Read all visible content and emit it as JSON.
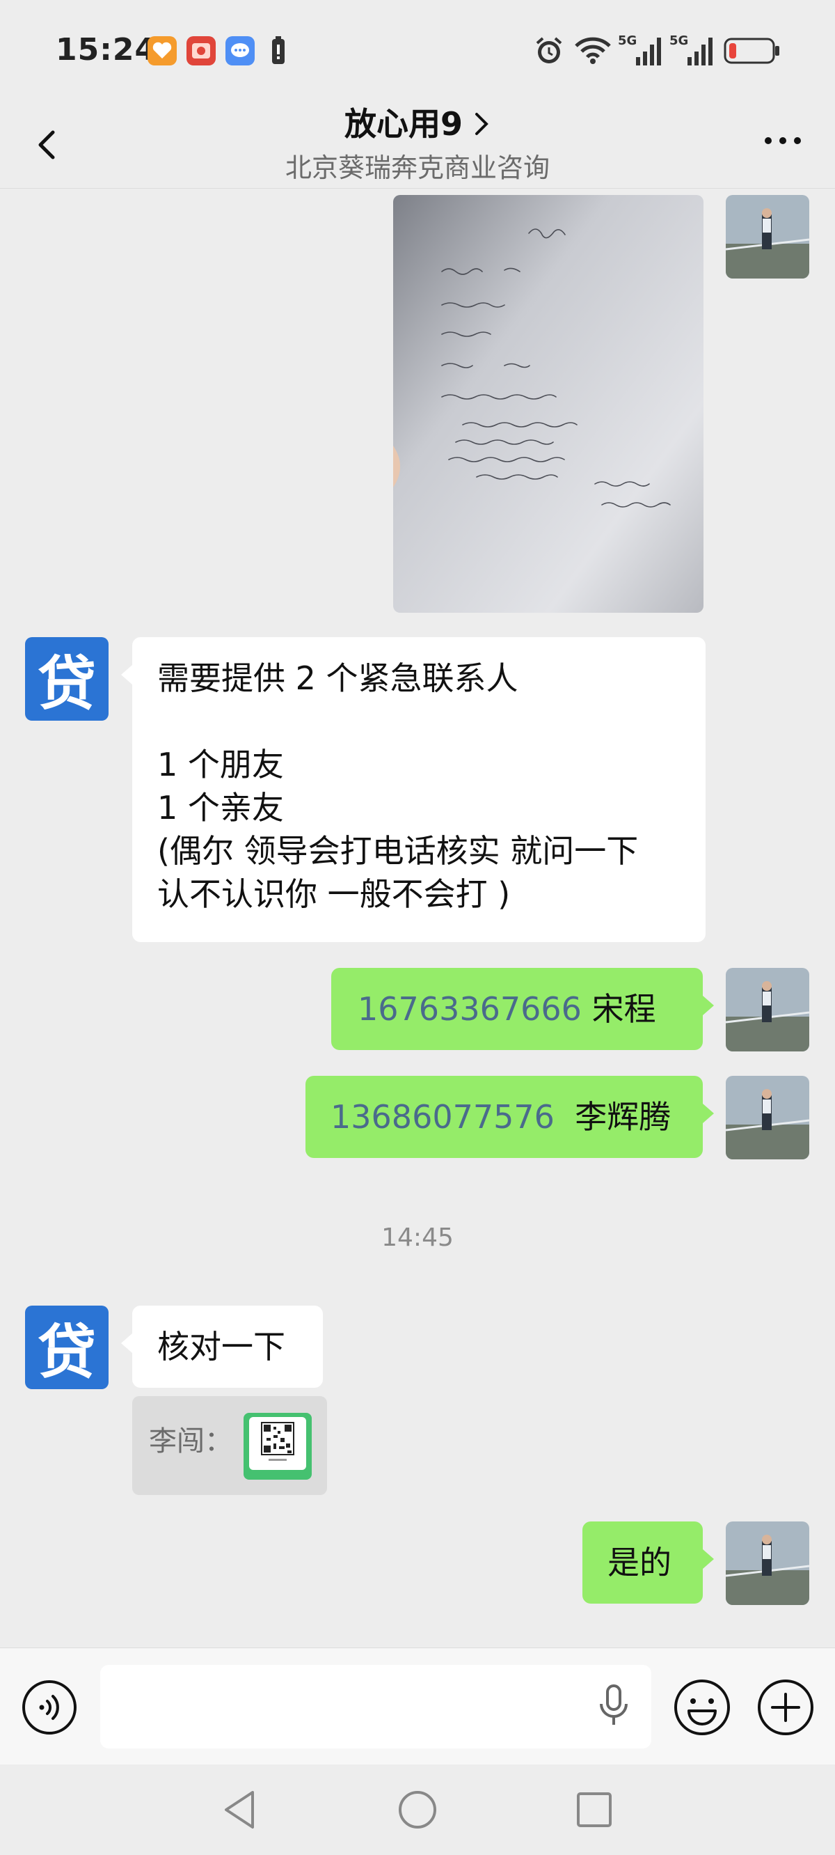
{
  "status_bar": {
    "time": "15:24",
    "icons": [
      "app-heart-icon",
      "app-red-icon",
      "message-icon",
      "battery-saver-icon",
      "alarm-icon",
      "wifi-icon",
      "signal-5g-1-icon",
      "signal-5g-2-icon",
      "battery-low-icon"
    ]
  },
  "header": {
    "title": "放心用9",
    "subtitle": "北京葵瑞奔克商业咨询"
  },
  "messages": {
    "m1": {
      "side": "right",
      "type": "image",
      "content": "handwritten IOU note"
    },
    "m2": {
      "side": "left",
      "avatar_text": "贷",
      "line1": "需要提供 2 个紧急联系人",
      "line2": "1 个朋友",
      "line3": "1 个亲友",
      "line4": "(偶尔 领导会打电话核实 就问一下",
      "line5": "认不认识你  一般不会打 )"
    },
    "m3": {
      "side": "right",
      "phone": "16763367666",
      "name": "宋程"
    },
    "m4": {
      "side": "right",
      "phone": "13686077576",
      "name": "李辉腾"
    },
    "timestamp": "14:45",
    "m5": {
      "side": "left",
      "avatar_text": "贷",
      "text": "核对一下"
    },
    "m5_quote": {
      "label": "李闯："
    },
    "m6": {
      "side": "right",
      "text": "是的"
    }
  },
  "input_bar": {
    "placeholder": ""
  },
  "colors": {
    "background": "#ededed",
    "green_bubble": "#95ec69",
    "white_bubble": "#ffffff",
    "loan_avatar": "#2b74d4",
    "phone_link": "#4a6a8c"
  }
}
